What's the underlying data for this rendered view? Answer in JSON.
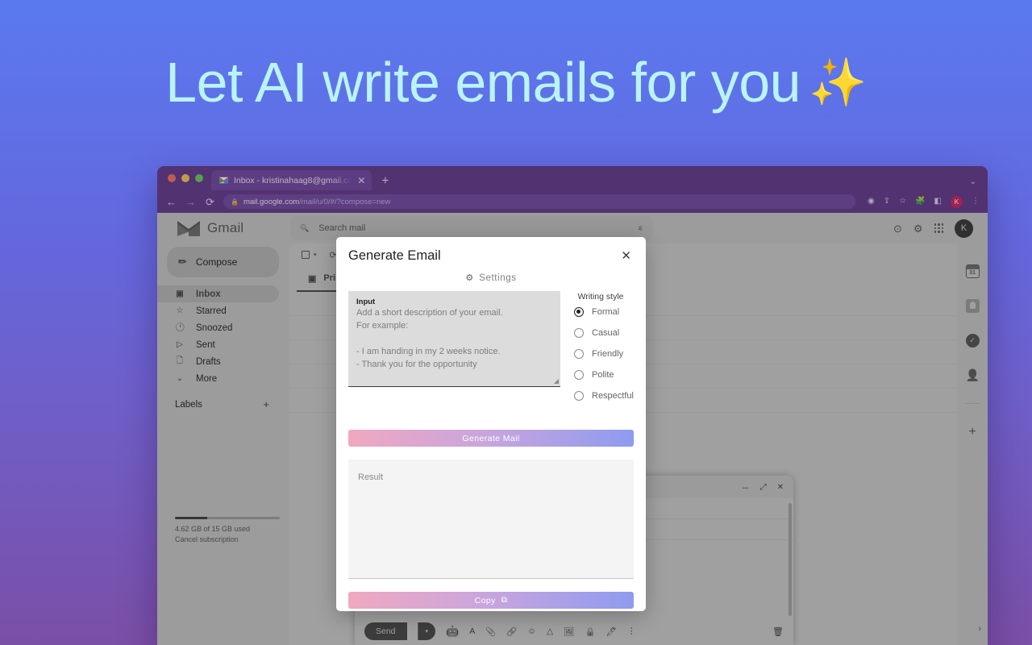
{
  "hero": {
    "headline": "Let AI write emails for you",
    "sparkles": "✨",
    "headline_color": "#b9f4f7",
    "bg_gradient_top": "#5b79ef",
    "bg_gradient_bottom": "#7a4fa6"
  },
  "browser": {
    "tab": {
      "title": "Inbox - kristinahaag8@gmail.co",
      "close": "✕",
      "favicon_name": "gmail-favicon"
    },
    "new_tab": "+",
    "window_chevron": "⌄",
    "nav": {
      "back": "←",
      "forward": "→",
      "reload": "⟳"
    },
    "omnibox": {
      "lock": "🔒",
      "url_host": "mail.google.com",
      "url_path": "/mail/u/0/#/?compose=new"
    },
    "toolbar_icons": [
      "eye-icon",
      "share-icon",
      "star-icon",
      "extensions-icon",
      "sidebar-icon"
    ],
    "profile_initial": "K",
    "menu": "⋮"
  },
  "gmail": {
    "logo_text": "Gmail",
    "search": {
      "placeholder": "Search mail",
      "icon": "search-icon",
      "filter_icon": "filter-icon"
    },
    "header_icons": {
      "help": "?",
      "settings": "⚙",
      "apps": "apps-grid-icon"
    },
    "avatar_initial": "K",
    "compose_label": "Compose",
    "nav_items": [
      {
        "label": "Inbox",
        "icon": "inbox-icon",
        "selected": true
      },
      {
        "label": "Starred",
        "icon": "star-icon",
        "selected": false
      },
      {
        "label": "Snoozed",
        "icon": "clock-icon",
        "selected": false
      },
      {
        "label": "Sent",
        "icon": "send-icon",
        "selected": false
      },
      {
        "label": "Drafts",
        "icon": "file-icon",
        "selected": false
      },
      {
        "label": "More",
        "icon": "chevron-down-icon",
        "selected": false
      }
    ],
    "labels_title": "Labels",
    "labels_add": "+",
    "storage": {
      "text_line1": "4.62 GB of 15 GB used",
      "text_line2": "Cancel subscription",
      "used_percent": 31
    },
    "list_tabs": [
      {
        "label": "Primary",
        "icon": "inbox-tab-icon",
        "active": true
      }
    ],
    "right_sidebar": [
      "calendar-icon",
      "keep-icon",
      "tasks-icon",
      "contacts-icon",
      "add-ons-plus-icon"
    ],
    "calendar_day": "31",
    "expand_arrow": "›"
  },
  "compose_window": {
    "minimize": "－",
    "expand": "⤢",
    "close": "✕",
    "send_label": "Send",
    "send_caret": "▾",
    "toolbar_icons": [
      "ai-robot-icon",
      "format-text-icon",
      "attach-icon",
      "link-icon",
      "emoji-icon",
      "drive-icon",
      "image-icon",
      "lock-icon",
      "signature-pen-icon",
      "more-options-icon"
    ],
    "trash": "trash-icon"
  },
  "modal": {
    "title": "Generate Email",
    "close": "✕",
    "settings_label": "Settings",
    "settings_icon": "gear-icon",
    "input": {
      "label": "Input",
      "placeholder": "Add a short description of your email.\nFor example:\n\n- I am handing in my 2 weeks notice.\n- Thank you for the opportunity"
    },
    "writing_style": {
      "title": "Writing style",
      "options": [
        {
          "label": "Formal",
          "selected": true
        },
        {
          "label": "Casual",
          "selected": false
        },
        {
          "label": "Friendly",
          "selected": false
        },
        {
          "label": "Polite",
          "selected": false
        },
        {
          "label": "Respectful",
          "selected": false
        }
      ]
    },
    "generate_button": "Generate Mail",
    "result_placeholder": "Result",
    "copy_button": "Copy",
    "copy_icon": "copy-icon",
    "gradient_start": "#f0a8c0",
    "gradient_end": "#8e9bf0"
  }
}
